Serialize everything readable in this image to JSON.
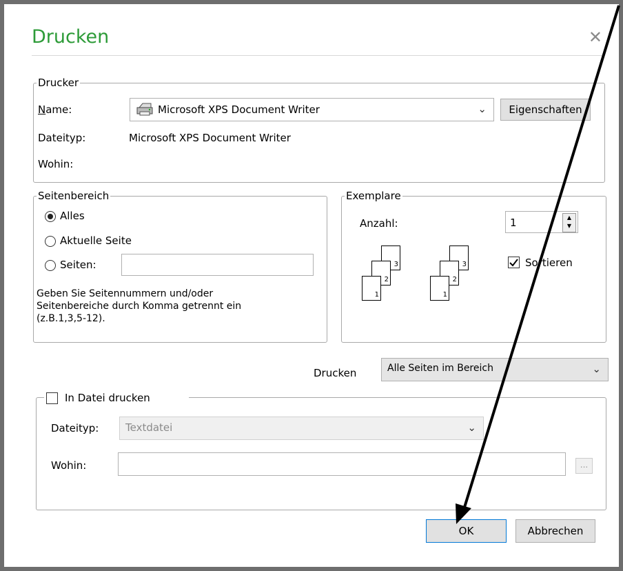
{
  "dialog": {
    "title": "Drucken",
    "close_glyph": "✕"
  },
  "printer": {
    "legend": "Drucker",
    "name_label": "Name:",
    "name_value": "Microsoft XPS Document Writer",
    "properties_button": "Eigenschaften",
    "type_label": "Dateityp:",
    "type_value": "Microsoft XPS Document Writer",
    "where_label": "Wohin:",
    "printer_icon": "printer-icon"
  },
  "page_range": {
    "legend": "Seitenbereich",
    "all_label": "Alles",
    "current_label": "Aktuelle Seite",
    "pages_label": "Seiten:",
    "pages_value": "",
    "hint_line1": "Geben Sie Seitennummern und/oder",
    "hint_line2": "Seitenbereiche durch Komma getrennt ein",
    "hint_line3": "(z.B.1,3,5-12).",
    "selected": "all"
  },
  "copies": {
    "legend": "Exemplare",
    "count_label": "Anzahl:",
    "count_value": "1",
    "collate_label": "Sortieren",
    "collate_checked": true,
    "page_numbers": [
      "1",
      "2",
      "3"
    ]
  },
  "print_what": {
    "label": "Drucken",
    "value": "Alle Seiten im Bereich"
  },
  "print_to_file": {
    "legend": "In Datei drucken",
    "checked": false,
    "type_label": "Dateityp:",
    "type_value": "Textdatei",
    "where_label": "Wohin:",
    "where_value": "",
    "browse_label": "..."
  },
  "buttons": {
    "ok": "OK",
    "cancel": "Abbrechen"
  },
  "colors": {
    "title": "#2d9b38",
    "default_border": "#0078d7"
  }
}
